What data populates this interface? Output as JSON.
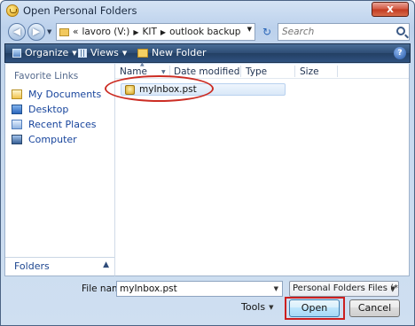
{
  "window": {
    "title": "Open Personal Folders",
    "close_label": "x"
  },
  "address": {
    "breadcrumbs": [
      "lavoro (V:)",
      "KIT",
      "outlook backup"
    ],
    "prefix": "«",
    "search_placeholder": "Search"
  },
  "toolbar": {
    "organize_label": "Organize",
    "views_label": "Views",
    "new_folder_label": "New Folder",
    "help_label": "?"
  },
  "nav_pane": {
    "header": "Favorite Links",
    "items": [
      {
        "label": "My Documents",
        "icon": "documents-folder-icon"
      },
      {
        "label": "Desktop",
        "icon": "desktop-icon"
      },
      {
        "label": "Recent Places",
        "icon": "recent-places-icon"
      },
      {
        "label": "Computer",
        "icon": "computer-icon"
      }
    ],
    "folders_label": "Folders"
  },
  "file_list": {
    "columns": [
      "Name",
      "Date modified",
      "Type",
      "Size"
    ],
    "files": [
      {
        "name": "myInbox.pst",
        "icon": "pst-file-icon"
      }
    ]
  },
  "footer": {
    "file_name_label": "File name:",
    "file_name_value": "myInbox.pst",
    "filter_value": "Personal Folders Files (*.pst)",
    "tools_label": "Tools",
    "open_label": "Open",
    "cancel_label": "Cancel"
  },
  "colors": {
    "highlight": "#cc2d24",
    "toolbar": "#2d4c74",
    "link": "#17449c"
  }
}
